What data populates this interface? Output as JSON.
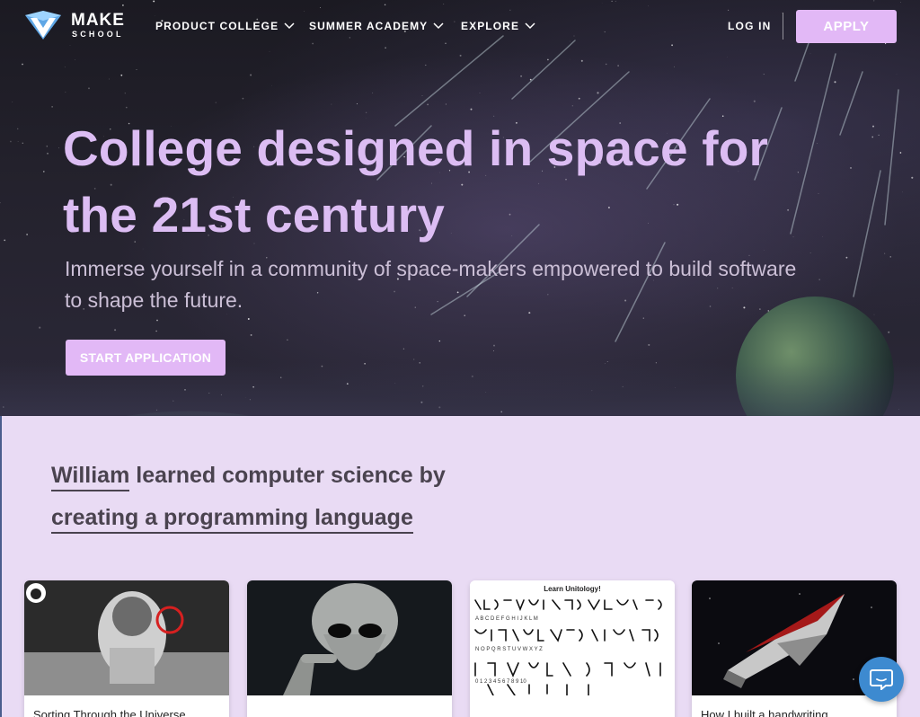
{
  "nav": {
    "logo_make": "MAKE",
    "logo_school": "SCHOOL",
    "items": [
      {
        "label": "PRODUCT COLLEGE"
      },
      {
        "label": "SUMMER ACADEMY"
      },
      {
        "label": "EXPLORE"
      }
    ],
    "login": "LOG IN",
    "apply": "APPLY"
  },
  "hero": {
    "title_line1": "College designed in space for",
    "title_line2": "the 21st century",
    "subtitle_line1": "Immerse yourself in a community of space-makers empowered to build software",
    "subtitle_line2": "to shape the future.",
    "cta": "START APPLICATION"
  },
  "story": {
    "name": "William",
    "middle": " learned computer science by",
    "link": "creating a programming language"
  },
  "cards": [
    {
      "title": "Sorting Through the Universe",
      "thumb": "astronaut-moon"
    },
    {
      "title": "",
      "thumb": "alien-portrait"
    },
    {
      "title": "",
      "thumb": "alphabet-chart",
      "thumb_heading": "Learn Unitology!"
    },
    {
      "title": "How I built a handwriting",
      "thumb": "spaceship"
    }
  ],
  "colors": {
    "accent": "#e2b8f6",
    "hero_title": "#dcbdf3",
    "section_bg": "#e9dbf4",
    "chat": "#3d8ad0"
  },
  "icons": {
    "logo": "make-school-logo",
    "chevron": "chevron-down-icon",
    "chat": "chat-icon"
  }
}
